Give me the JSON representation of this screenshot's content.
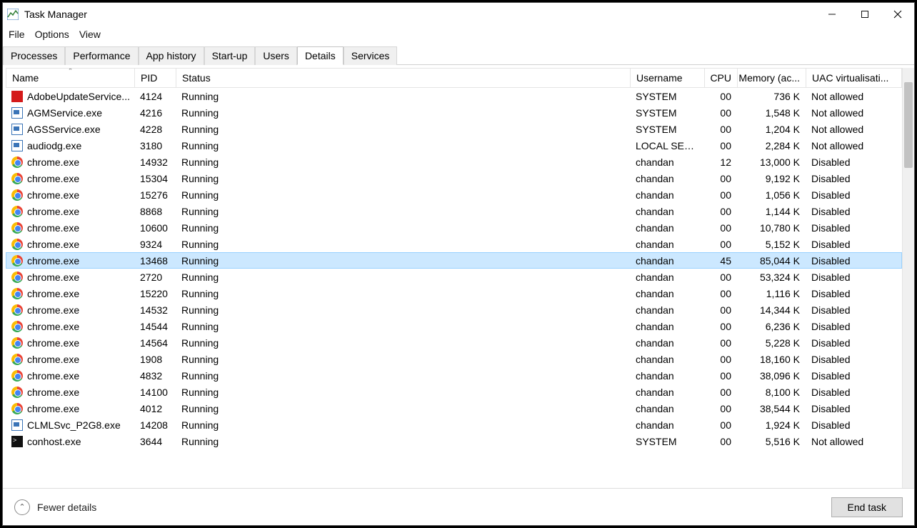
{
  "window": {
    "title": "Task Manager"
  },
  "menu": {
    "file": "File",
    "options": "Options",
    "view": "View"
  },
  "tabs": {
    "processes": "Processes",
    "performance": "Performance",
    "app_history": "App history",
    "startup": "Start-up",
    "users": "Users",
    "details": "Details",
    "services": "Services",
    "active": "details"
  },
  "columns": {
    "name": "Name",
    "pid": "PID",
    "status": "Status",
    "user": "Username",
    "cpu": "CPU",
    "mem": "Memory (ac...",
    "uac": "UAC virtualisati..."
  },
  "footer": {
    "fewer": "Fewer details",
    "end_task": "End task"
  },
  "selected_index": 10,
  "rows": [
    {
      "icon": "adobe",
      "name": "AdobeUpdateService...",
      "pid": "4124",
      "status": "Running",
      "user": "SYSTEM",
      "cpu": "00",
      "mem": "736 K",
      "uac": "Not allowed"
    },
    {
      "icon": "generic",
      "name": "AGMService.exe",
      "pid": "4216",
      "status": "Running",
      "user": "SYSTEM",
      "cpu": "00",
      "mem": "1,548 K",
      "uac": "Not allowed"
    },
    {
      "icon": "generic",
      "name": "AGSService.exe",
      "pid": "4228",
      "status": "Running",
      "user": "SYSTEM",
      "cpu": "00",
      "mem": "1,204 K",
      "uac": "Not allowed"
    },
    {
      "icon": "generic",
      "name": "audiodg.exe",
      "pid": "3180",
      "status": "Running",
      "user": "LOCAL SER...",
      "cpu": "00",
      "mem": "2,284 K",
      "uac": "Not allowed"
    },
    {
      "icon": "chrome",
      "name": "chrome.exe",
      "pid": "14932",
      "status": "Running",
      "user": "chandan",
      "cpu": "12",
      "mem": "13,000 K",
      "uac": "Disabled"
    },
    {
      "icon": "chrome",
      "name": "chrome.exe",
      "pid": "15304",
      "status": "Running",
      "user": "chandan",
      "cpu": "00",
      "mem": "9,192 K",
      "uac": "Disabled"
    },
    {
      "icon": "chrome",
      "name": "chrome.exe",
      "pid": "15276",
      "status": "Running",
      "user": "chandan",
      "cpu": "00",
      "mem": "1,056 K",
      "uac": "Disabled"
    },
    {
      "icon": "chrome",
      "name": "chrome.exe",
      "pid": "8868",
      "status": "Running",
      "user": "chandan",
      "cpu": "00",
      "mem": "1,144 K",
      "uac": "Disabled"
    },
    {
      "icon": "chrome",
      "name": "chrome.exe",
      "pid": "10600",
      "status": "Running",
      "user": "chandan",
      "cpu": "00",
      "mem": "10,780 K",
      "uac": "Disabled"
    },
    {
      "icon": "chrome",
      "name": "chrome.exe",
      "pid": "9324",
      "status": "Running",
      "user": "chandan",
      "cpu": "00",
      "mem": "5,152 K",
      "uac": "Disabled"
    },
    {
      "icon": "chrome",
      "name": "chrome.exe",
      "pid": "13468",
      "status": "Running",
      "user": "chandan",
      "cpu": "45",
      "mem": "85,044 K",
      "uac": "Disabled"
    },
    {
      "icon": "chrome",
      "name": "chrome.exe",
      "pid": "2720",
      "status": "Running",
      "user": "chandan",
      "cpu": "00",
      "mem": "53,324 K",
      "uac": "Disabled"
    },
    {
      "icon": "chrome",
      "name": "chrome.exe",
      "pid": "15220",
      "status": "Running",
      "user": "chandan",
      "cpu": "00",
      "mem": "1,116 K",
      "uac": "Disabled"
    },
    {
      "icon": "chrome",
      "name": "chrome.exe",
      "pid": "14532",
      "status": "Running",
      "user": "chandan",
      "cpu": "00",
      "mem": "14,344 K",
      "uac": "Disabled"
    },
    {
      "icon": "chrome",
      "name": "chrome.exe",
      "pid": "14544",
      "status": "Running",
      "user": "chandan",
      "cpu": "00",
      "mem": "6,236 K",
      "uac": "Disabled"
    },
    {
      "icon": "chrome",
      "name": "chrome.exe",
      "pid": "14564",
      "status": "Running",
      "user": "chandan",
      "cpu": "00",
      "mem": "5,228 K",
      "uac": "Disabled"
    },
    {
      "icon": "chrome",
      "name": "chrome.exe",
      "pid": "1908",
      "status": "Running",
      "user": "chandan",
      "cpu": "00",
      "mem": "18,160 K",
      "uac": "Disabled"
    },
    {
      "icon": "chrome",
      "name": "chrome.exe",
      "pid": "4832",
      "status": "Running",
      "user": "chandan",
      "cpu": "00",
      "mem": "38,096 K",
      "uac": "Disabled"
    },
    {
      "icon": "chrome",
      "name": "chrome.exe",
      "pid": "14100",
      "status": "Running",
      "user": "chandan",
      "cpu": "00",
      "mem": "8,100 K",
      "uac": "Disabled"
    },
    {
      "icon": "chrome",
      "name": "chrome.exe",
      "pid": "4012",
      "status": "Running",
      "user": "chandan",
      "cpu": "00",
      "mem": "38,544 K",
      "uac": "Disabled"
    },
    {
      "icon": "generic",
      "name": "CLMLSvc_P2G8.exe",
      "pid": "14208",
      "status": "Running",
      "user": "chandan",
      "cpu": "00",
      "mem": "1,924 K",
      "uac": "Disabled"
    },
    {
      "icon": "cmd",
      "name": "conhost.exe",
      "pid": "3644",
      "status": "Running",
      "user": "SYSTEM",
      "cpu": "00",
      "mem": "5,516 K",
      "uac": "Not allowed"
    }
  ]
}
